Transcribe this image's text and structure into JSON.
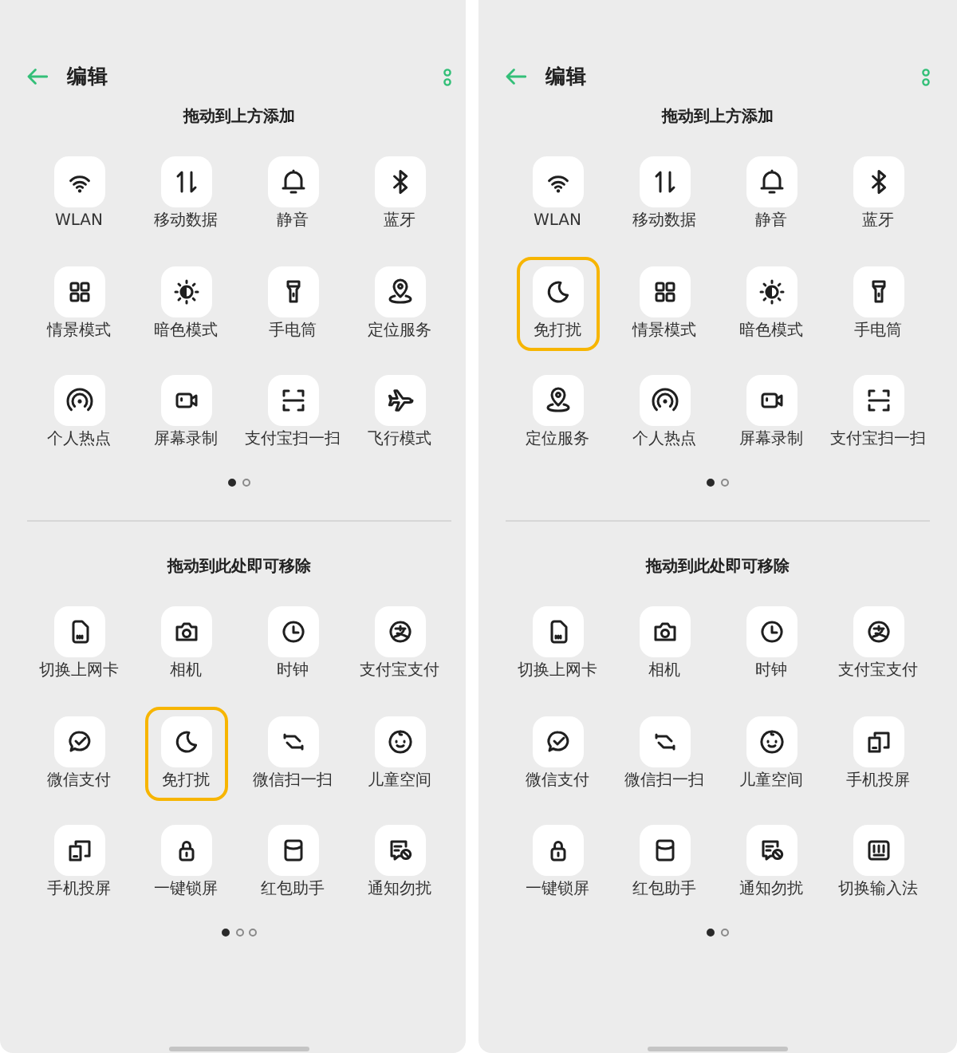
{
  "phones": [
    {
      "header": {
        "title": "编辑"
      },
      "add_area": {
        "heading": "拖动到上方添加",
        "tiles": [
          {
            "kind": "wifi",
            "label": "WLAN",
            "selected": false
          },
          {
            "kind": "data",
            "label": "移动数据",
            "selected": false
          },
          {
            "kind": "bell",
            "label": "静音",
            "selected": false
          },
          {
            "kind": "bluetooth",
            "label": "蓝牙",
            "selected": false
          },
          {
            "kind": "grid",
            "label": "情景模式",
            "selected": false
          },
          {
            "kind": "contrast",
            "label": "暗色模式",
            "selected": false
          },
          {
            "kind": "flashlight",
            "label": "手电筒",
            "selected": false
          },
          {
            "kind": "location",
            "label": "定位服务",
            "selected": false
          },
          {
            "kind": "hotspot",
            "label": "个人热点",
            "selected": false
          },
          {
            "kind": "record",
            "label": "屏幕录制",
            "selected": false
          },
          {
            "kind": "scan",
            "label": "支付宝扫一扫",
            "selected": false
          },
          {
            "kind": "airplane",
            "label": "飞行模式",
            "selected": false
          }
        ],
        "pages": [
          {
            "selected": true
          },
          {
            "selected": false
          }
        ]
      },
      "remove_area": {
        "heading": "拖动到此处即可移除",
        "tiles": [
          {
            "kind": "sim",
            "label": "切换上网卡",
            "selected": false
          },
          {
            "kind": "camera",
            "label": "相机",
            "selected": false
          },
          {
            "kind": "clock",
            "label": "时钟",
            "selected": false
          },
          {
            "kind": "pay",
            "label": "支付宝支付",
            "selected": false
          },
          {
            "kind": "chatpay",
            "label": "微信支付",
            "selected": false
          },
          {
            "kind": "moon",
            "label": "免打扰",
            "selected": true
          },
          {
            "kind": "swap",
            "label": "微信扫一扫",
            "selected": false
          },
          {
            "kind": "baby",
            "label": "儿童空间",
            "selected": false
          },
          {
            "kind": "cast",
            "label": "手机投屏",
            "selected": false
          },
          {
            "kind": "lock",
            "label": "一键锁屏",
            "selected": false
          },
          {
            "kind": "envelope",
            "label": "红包助手",
            "selected": false
          },
          {
            "kind": "notice",
            "label": "通知勿扰",
            "selected": false
          }
        ],
        "pages": [
          {
            "selected": true
          },
          {
            "selected": false
          },
          {
            "selected": false
          }
        ]
      }
    },
    {
      "header": {
        "title": "编辑"
      },
      "add_area": {
        "heading": "拖动到上方添加",
        "tiles": [
          {
            "kind": "wifi",
            "label": "WLAN",
            "selected": false
          },
          {
            "kind": "data",
            "label": "移动数据",
            "selected": false
          },
          {
            "kind": "bell",
            "label": "静音",
            "selected": false
          },
          {
            "kind": "bluetooth",
            "label": "蓝牙",
            "selected": false
          },
          {
            "kind": "moon",
            "label": "免打扰",
            "selected": true
          },
          {
            "kind": "grid",
            "label": "情景模式",
            "selected": false
          },
          {
            "kind": "contrast",
            "label": "暗色模式",
            "selected": false
          },
          {
            "kind": "flashlight",
            "label": "手电筒",
            "selected": false
          },
          {
            "kind": "location",
            "label": "定位服务",
            "selected": false
          },
          {
            "kind": "hotspot",
            "label": "个人热点",
            "selected": false
          },
          {
            "kind": "record",
            "label": "屏幕录制",
            "selected": false
          },
          {
            "kind": "scan",
            "label": "支付宝扫一扫",
            "selected": false
          }
        ],
        "pages": [
          {
            "selected": true
          },
          {
            "selected": false
          }
        ]
      },
      "remove_area": {
        "heading": "拖动到此处即可移除",
        "tiles": [
          {
            "kind": "sim",
            "label": "切换上网卡",
            "selected": false
          },
          {
            "kind": "camera",
            "label": "相机",
            "selected": false
          },
          {
            "kind": "clock",
            "label": "时钟",
            "selected": false
          },
          {
            "kind": "pay",
            "label": "支付宝支付",
            "selected": false
          },
          {
            "kind": "chatpay",
            "label": "微信支付",
            "selected": false
          },
          {
            "kind": "swap",
            "label": "微信扫一扫",
            "selected": false
          },
          {
            "kind": "baby",
            "label": "儿童空间",
            "selected": false
          },
          {
            "kind": "cast",
            "label": "手机投屏",
            "selected": false
          },
          {
            "kind": "lock",
            "label": "一键锁屏",
            "selected": false
          },
          {
            "kind": "envelope",
            "label": "红包助手",
            "selected": false
          },
          {
            "kind": "notice",
            "label": "通知勿扰",
            "selected": false
          },
          {
            "kind": "keyboard",
            "label": "切换输入法",
            "selected": false
          }
        ],
        "pages": [
          {
            "selected": true
          },
          {
            "selected": false
          }
        ]
      }
    }
  ]
}
